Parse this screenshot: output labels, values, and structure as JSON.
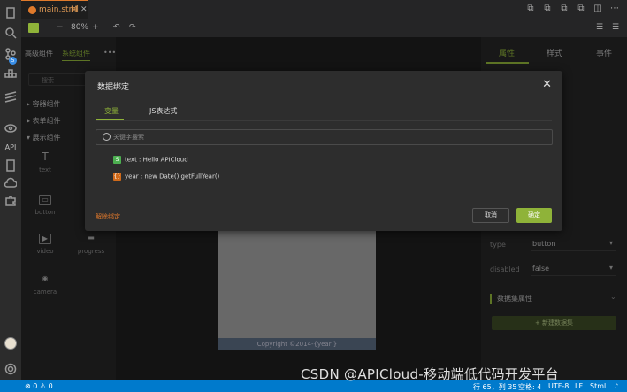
{
  "tab": {
    "filename": "main.stml",
    "modified": "M"
  },
  "toolbar": {
    "zoom": "80%",
    "minus": "−",
    "plus": "+"
  },
  "activity": {
    "badge": "5",
    "api_label": "API"
  },
  "left_panel": {
    "tabs": [
      "高级组件",
      "系统组件"
    ],
    "more": "•••",
    "search_placeholder": "搜索",
    "groups": [
      "容器组件",
      "表单组件",
      "展示组件"
    ],
    "components": [
      {
        "label": "text",
        "icon": "T"
      },
      {
        "label": "button",
        "icon": "▭"
      },
      {
        "label": "video",
        "icon": "▶"
      },
      {
        "label": "progress",
        "icon": "▬"
      },
      {
        "label": "camera",
        "icon": "◉"
      }
    ]
  },
  "canvas": {
    "footer": "Copyright ©2014-{year }"
  },
  "right_panel": {
    "tabs": [
      "属性",
      "样式",
      "事件"
    ],
    "fields": [
      {
        "label": "type",
        "value": "button"
      },
      {
        "label": "disabled",
        "value": "false"
      }
    ],
    "section_title": "数据集属性",
    "new_dataset_label": "+ 新建数据集"
  },
  "modal": {
    "title": "数据绑定",
    "tabs": [
      "变量",
      "JS表达式"
    ],
    "search_placeholder": "关键字搜索",
    "variables": [
      {
        "badge": "S",
        "text": "text : Hello APICloud"
      },
      {
        "badge": "{}",
        "text": "year : new Date().getFullYear()"
      }
    ],
    "unbind": "解除绑定",
    "cancel": "取消",
    "confirm": "确定"
  },
  "status": {
    "left": "⊗ 0 ⚠ 0",
    "position": "行 65，列 35",
    "spaces": "空格: 4",
    "encoding": "UTF-8",
    "eol": "LF",
    "lang": "Stml"
  },
  "watermark": "CSDN @APICloud-移动端低代码开发平台",
  "colors": {
    "accent": "#8fb339",
    "tab_orange": "#e07a2b",
    "statusbar": "#007acc"
  }
}
